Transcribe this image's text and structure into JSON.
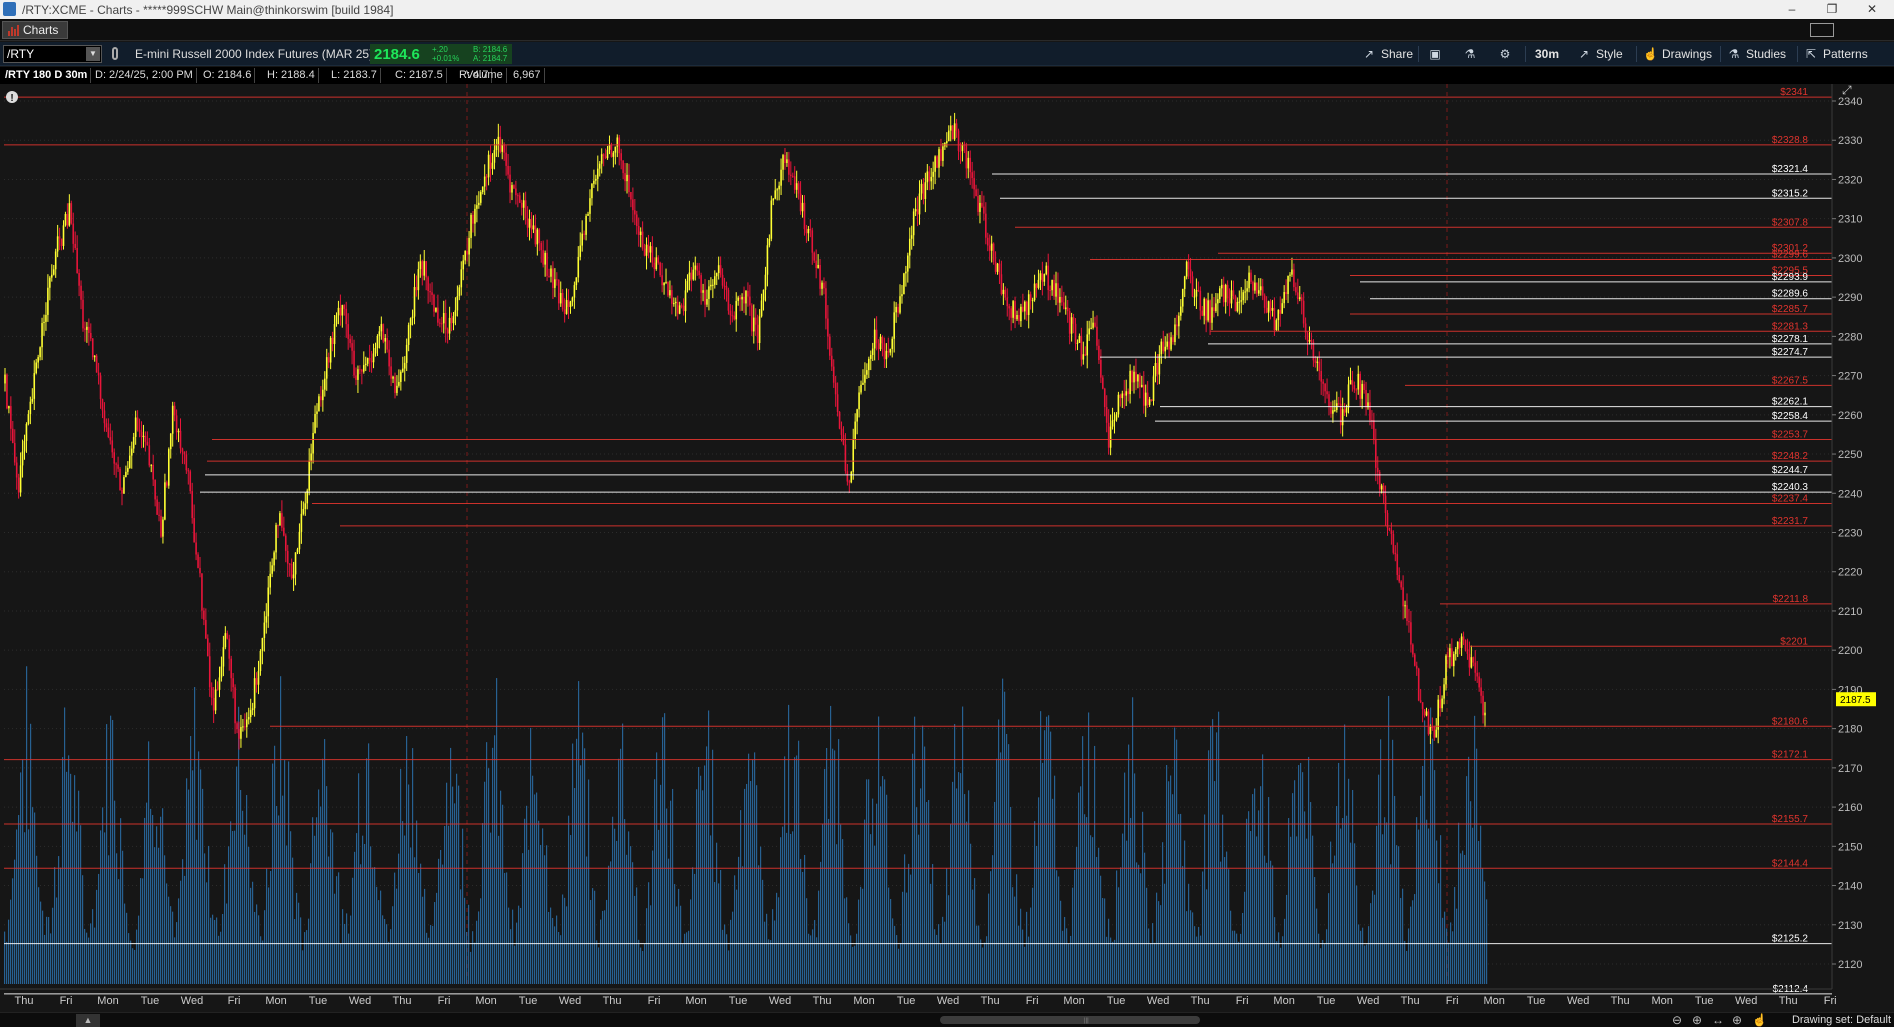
{
  "window": {
    "title": "/RTY:XCME - Charts - *****999SCHW Main@thinkorswim [build 1984]",
    "controls": [
      "–",
      "❐",
      "✕"
    ]
  },
  "tab": {
    "label": "Charts"
  },
  "toolbar": {
    "symbol": "/RTY",
    "description": "E-mini Russell 2000 Index Futures (MAR 25)",
    "last": "2184.6",
    "change": "+.20",
    "change_pct": "+0.01%",
    "bid": "B: 2184.6",
    "ask": "A: 2184.7",
    "share": "Share",
    "timeframe": "30m",
    "style": "Style",
    "drawings": "Drawings",
    "studies": "Studies",
    "patterns": "Patterns"
  },
  "infobar": {
    "title": "/RTY 180 D 30m",
    "date": "D: 2/24/25, 2:00 PM",
    "open": "O: 2184.6",
    "high": "H: 2188.4",
    "low": "L: 2183.7",
    "close": "C: 2187.5",
    "range": "R: 4.7",
    "volume_label": "Volume",
    "volume_value": "6,967"
  },
  "chart_data": {
    "type": "candlestick",
    "symbol": "/RTY",
    "interval": "30m",
    "ylim": [
      2110,
      2343
    ],
    "y_ticks": [
      2120,
      2130,
      2140,
      2150,
      2160,
      2170,
      2180,
      2190,
      2200,
      2210,
      2220,
      2230,
      2240,
      2250,
      2260,
      2270,
      2280,
      2290,
      2300,
      2310,
      2320,
      2330,
      2340
    ],
    "current_price": "2187.5",
    "x_ticks": [
      "Thu",
      "Fri",
      "Mon",
      "Tue",
      "Wed",
      "Fri",
      "Mon",
      "Tue",
      "Wed",
      "Thu",
      "Fri",
      "Mon",
      "Tue",
      "Wed",
      "Thu",
      "Fri",
      "Mon",
      "Tue",
      "Wed",
      "Thu",
      "Mon",
      "Tue",
      "Wed",
      "Thu",
      "Fri",
      "Mon",
      "Tue",
      "Wed",
      "Thu",
      "Fri",
      "Mon",
      "Tue",
      "Wed",
      "Thu",
      "Fri",
      "Mon",
      "Tue",
      "Wed",
      "Thu",
      "Mon",
      "Tue",
      "Wed",
      "Thu",
      "Fri"
    ],
    "price_path": [
      2268,
      2242,
      2262,
      2286,
      2302,
      2312,
      2284,
      2272,
      2254,
      2240,
      2258,
      2250,
      2230,
      2262,
      2246,
      2218,
      2184,
      2205,
      2176,
      2185,
      2208,
      2235,
      2218,
      2236,
      2262,
      2276,
      2290,
      2268,
      2274,
      2282,
      2265,
      2278,
      2300,
      2288,
      2282,
      2292,
      2310,
      2322,
      2330,
      2318,
      2312,
      2305,
      2295,
      2288,
      2294,
      2315,
      2325,
      2330,
      2318,
      2304,
      2300,
      2292,
      2286,
      2298,
      2290,
      2296,
      2285,
      2290,
      2278,
      2312,
      2326,
      2316,
      2306,
      2292,
      2264,
      2242,
      2270,
      2280,
      2276,
      2292,
      2310,
      2320,
      2326,
      2333,
      2326,
      2313,
      2302,
      2290,
      2284,
      2290,
      2296,
      2292,
      2283,
      2276,
      2282,
      2252,
      2266,
      2270,
      2262,
      2276,
      2280,
      2297,
      2288,
      2286,
      2292,
      2286,
      2295,
      2288,
      2283,
      2296,
      2285,
      2272,
      2262,
      2260,
      2270,
      2262,
      2240,
      2225,
      2208,
      2188,
      2178,
      2196,
      2202,
      2196,
      2183
    ],
    "levels": [
      {
        "price": 2341,
        "label": "$2341",
        "color": "#e0342e"
      },
      {
        "price": 2328.8,
        "label": "$2328.8",
        "color": "#e0342e"
      },
      {
        "price": 2321.4,
        "label": "$2321.4",
        "color": "#ffffff"
      },
      {
        "price": 2315.2,
        "label": "$2315.2",
        "color": "#ffffff"
      },
      {
        "price": 2307.8,
        "label": "$2307.8",
        "color": "#e0342e"
      },
      {
        "price": 2301.2,
        "label": "$2301.2",
        "color": "#e0342e"
      },
      {
        "price": 2299.6,
        "label": "$2299.6",
        "color": "#e0342e"
      },
      {
        "price": 2295.5,
        "label": "$2295.5",
        "color": "#e0342e"
      },
      {
        "price": 2293.9,
        "label": "$2293.9",
        "color": "#ffffff"
      },
      {
        "price": 2289.6,
        "label": "$2289.6",
        "color": "#ffffff"
      },
      {
        "price": 2285.7,
        "label": "$2285.7",
        "color": "#e0342e"
      },
      {
        "price": 2281.3,
        "label": "$2281.3",
        "color": "#e0342e"
      },
      {
        "price": 2278.1,
        "label": "$2278.1",
        "color": "#ffffff"
      },
      {
        "price": 2274.7,
        "label": "$2274.7",
        "color": "#ffffff"
      },
      {
        "price": 2267.5,
        "label": "$2267.5",
        "color": "#e0342e"
      },
      {
        "price": 2262.1,
        "label": "$2262.1",
        "color": "#ffffff"
      },
      {
        "price": 2258.4,
        "label": "$2258.4",
        "color": "#ffffff"
      },
      {
        "price": 2253.7,
        "label": "$2253.7",
        "color": "#e0342e"
      },
      {
        "price": 2248.2,
        "label": "$2248.2",
        "color": "#e0342e"
      },
      {
        "price": 2244.7,
        "label": "$2244.7",
        "color": "#ffffff"
      },
      {
        "price": 2240.3,
        "label": "$2240.3",
        "color": "#ffffff"
      },
      {
        "price": 2237.4,
        "label": "$2237.4",
        "color": "#e0342e"
      },
      {
        "price": 2231.7,
        "label": "$2231.7",
        "color": "#e0342e"
      },
      {
        "price": 2211.8,
        "label": "$2211.8",
        "color": "#e0342e"
      },
      {
        "price": 2201,
        "label": "$2201",
        "color": "#e0342e"
      },
      {
        "price": 2180.6,
        "label": "$2180.6",
        "color": "#e0342e"
      },
      {
        "price": 2172.1,
        "label": "$2172.1",
        "color": "#e0342e"
      },
      {
        "price": 2155.7,
        "label": "$2155.7",
        "color": "#e0342e"
      },
      {
        "price": 2144.4,
        "label": "$2144.4",
        "color": "#e0342e"
      },
      {
        "price": 2125.2,
        "label": "$2125.2",
        "color": "#ffffff"
      },
      {
        "price": 2112.4,
        "label": "$2112.4",
        "color": "#ffffff"
      }
    ]
  },
  "bottombar": {
    "drawing_set": "Drawing set: Default"
  },
  "colors": {
    "up": "#ffff33",
    "down": "#e8153a",
    "volume": "#2a6fa8",
    "support": "#e0342e",
    "price_tag": "#ffff00"
  }
}
